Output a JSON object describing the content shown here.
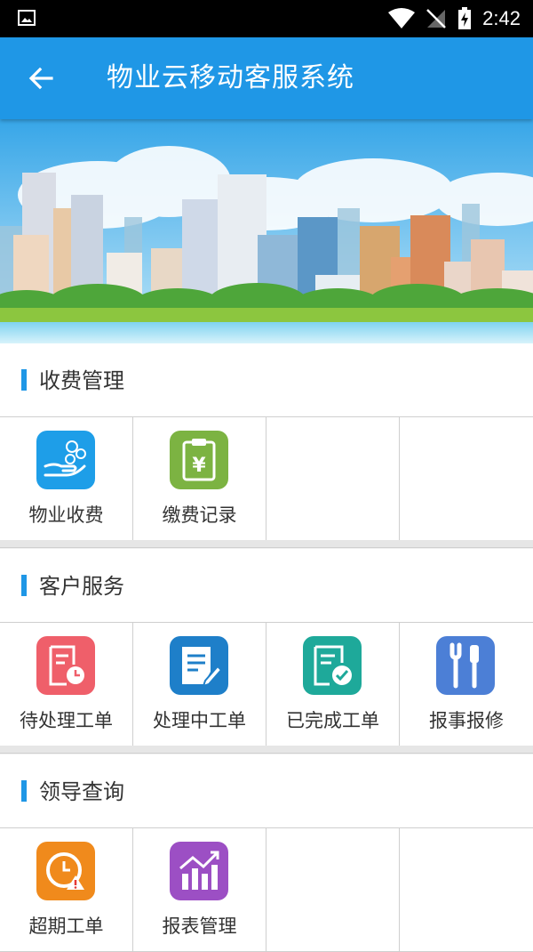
{
  "status_bar": {
    "time": "2:42",
    "icons": [
      "image-icon",
      "wifi-icon",
      "no-signal-icon",
      "battery-charging-icon"
    ]
  },
  "app_bar": {
    "title": "物业云移动客服系统",
    "back_icon": "back-arrow-icon",
    "color": "#1f97e6"
  },
  "banner": {
    "icon": "city-skyline-banner"
  },
  "sections": [
    {
      "title": "收费管理",
      "items": [
        {
          "label": "物业收费",
          "icon": "hand-coins-icon",
          "color": "#1e9ee8"
        },
        {
          "label": "缴费记录",
          "icon": "yen-clipboard-icon",
          "color": "#7cb342"
        }
      ]
    },
    {
      "title": "客户服务",
      "items": [
        {
          "label": "待处理工单",
          "icon": "pending-order-icon",
          "color": "#ef5f6a"
        },
        {
          "label": "处理中工单",
          "icon": "processing-order-icon",
          "color": "#1e7fc9"
        },
        {
          "label": "已完成工单",
          "icon": "completed-order-icon",
          "color": "#1ea99a"
        },
        {
          "label": "报事报修",
          "icon": "repair-tools-icon",
          "color": "#4c7fd6"
        }
      ]
    },
    {
      "title": "领导查询",
      "items": [
        {
          "label": "超期工单",
          "icon": "overdue-clock-icon",
          "color": "#f08a1c"
        },
        {
          "label": "报表管理",
          "icon": "report-chart-icon",
          "color": "#9c4fc4"
        }
      ]
    }
  ]
}
